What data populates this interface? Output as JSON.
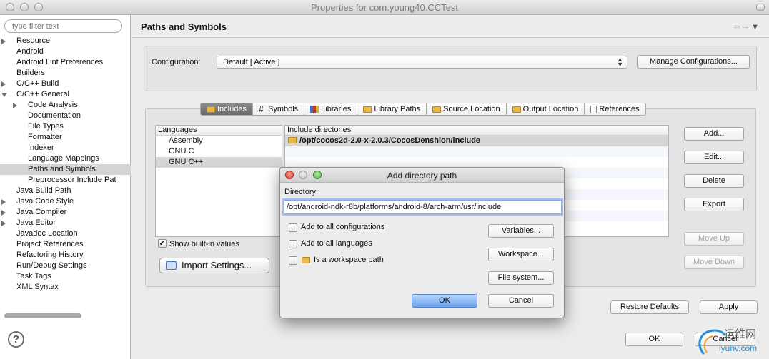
{
  "window": {
    "title": "Properties for com.young40.CCTest"
  },
  "sidebar": {
    "filter_placeholder": "type filter text",
    "items": [
      {
        "label": "Resource",
        "indent": 1,
        "toggle": "collapsed"
      },
      {
        "label": "Android",
        "indent": 1,
        "toggle": "none"
      },
      {
        "label": "Android Lint Preferences",
        "indent": 1,
        "toggle": "none"
      },
      {
        "label": "Builders",
        "indent": 1,
        "toggle": "none"
      },
      {
        "label": "C/C++ Build",
        "indent": 1,
        "toggle": "collapsed"
      },
      {
        "label": "C/C++ General",
        "indent": 1,
        "toggle": "expanded"
      },
      {
        "label": "Code Analysis",
        "indent": 2,
        "toggle": "collapsed"
      },
      {
        "label": "Documentation",
        "indent": 2,
        "toggle": "none"
      },
      {
        "label": "File Types",
        "indent": 2,
        "toggle": "none"
      },
      {
        "label": "Formatter",
        "indent": 2,
        "toggle": "none"
      },
      {
        "label": "Indexer",
        "indent": 2,
        "toggle": "none"
      },
      {
        "label": "Language Mappings",
        "indent": 2,
        "toggle": "none"
      },
      {
        "label": "Paths and Symbols",
        "indent": 2,
        "toggle": "none",
        "selected": true
      },
      {
        "label": "Preprocessor Include Pat",
        "indent": 2,
        "toggle": "none"
      },
      {
        "label": "Java Build Path",
        "indent": 1,
        "toggle": "none"
      },
      {
        "label": "Java Code Style",
        "indent": 1,
        "toggle": "collapsed"
      },
      {
        "label": "Java Compiler",
        "indent": 1,
        "toggle": "collapsed"
      },
      {
        "label": "Java Editor",
        "indent": 1,
        "toggle": "collapsed"
      },
      {
        "label": "Javadoc Location",
        "indent": 1,
        "toggle": "none"
      },
      {
        "label": "Project References",
        "indent": 1,
        "toggle": "none"
      },
      {
        "label": "Refactoring History",
        "indent": 1,
        "toggle": "none"
      },
      {
        "label": "Run/Debug Settings",
        "indent": 1,
        "toggle": "none"
      },
      {
        "label": "Task Tags",
        "indent": 1,
        "toggle": "none"
      },
      {
        "label": "XML Syntax",
        "indent": 1,
        "toggle": "none"
      }
    ],
    "help_label": "?"
  },
  "page": {
    "title": "Paths and Symbols",
    "nav": {
      "back": "⇦",
      "forward": "⇨",
      "menu": "▼"
    }
  },
  "config": {
    "label": "Configuration:",
    "value": "Default  [ Active ]",
    "manage_button": "Manage Configurations..."
  },
  "tabs": [
    {
      "label": "Includes",
      "icon": "folder-icon",
      "active": true
    },
    {
      "label": "Symbols",
      "icon": "hash-icon"
    },
    {
      "label": "Libraries",
      "icon": "books-icon"
    },
    {
      "label": "Library Paths",
      "icon": "folder-icon"
    },
    {
      "label": "Source Location",
      "icon": "folder-icon"
    },
    {
      "label": "Output Location",
      "icon": "folder-icon"
    },
    {
      "label": "References",
      "icon": "doc-icon"
    }
  ],
  "languages": {
    "header": "Languages",
    "items": [
      "Assembly",
      "GNU C",
      "GNU C++"
    ],
    "selected": "GNU C++"
  },
  "includes": {
    "header": "Include directories",
    "items": [
      "/opt/cocos2d-2.0-x-2.0.3/CocosDenshion/include"
    ]
  },
  "right_buttons": {
    "add": "Add...",
    "edit": "Edit...",
    "delete": "Delete",
    "export": "Export",
    "move_up": "Move Up",
    "move_down": "Move Down"
  },
  "show_builtin": {
    "label": "Show built-in values",
    "checked": true
  },
  "import_button": "Import Settings...",
  "footer": {
    "restore": "Restore Defaults",
    "apply": "Apply",
    "ok": "OK",
    "cancel": "Cancel"
  },
  "dialog": {
    "title": "Add directory path",
    "directory_label": "Directory:",
    "directory_value": "/opt/android-ndk-r8b/platforms/android-8/arch-arm/usr/include",
    "options": [
      {
        "label": "Add to all configurations",
        "checked": false
      },
      {
        "label": "Add to all languages",
        "checked": false
      },
      {
        "label": "Is a workspace path",
        "checked": false
      }
    ],
    "variables_button": "Variables...",
    "workspace_button": "Workspace...",
    "filesystem_button": "File system...",
    "ok": "OK",
    "cancel": "Cancel"
  },
  "watermark": {
    "brand_cn": "运维网",
    "domain": "iyunv.com"
  }
}
